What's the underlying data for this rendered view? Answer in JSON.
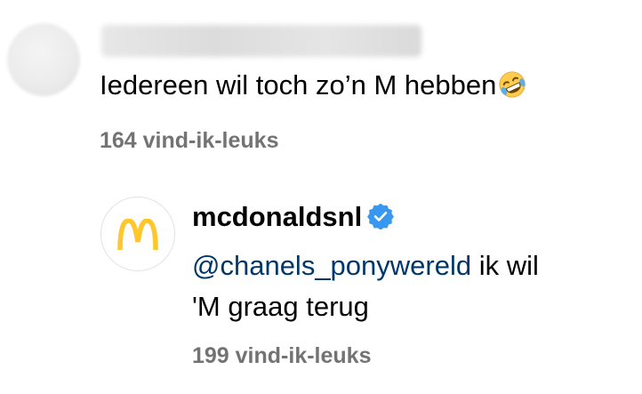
{
  "comment": {
    "username": "chanels_ponywereld",
    "text": "Iedereen wil toch zo’n M hebben",
    "emoji": "rolling-on-the-floor-laughing-emoji",
    "likes": "164 vind-ik-leuks"
  },
  "reply": {
    "username": "mcdonaldsnl",
    "verified_icon": "verified-badge-icon",
    "mention": "@chanels_ponywereld",
    "text_after_mention": " ik wil",
    "text_line2": "'M graag terug",
    "likes": "199 vind-ik-leuks"
  },
  "colors": {
    "mention": "#00376b",
    "secondary_text": "#737373",
    "verified_blue": "#3897f0",
    "mcdonalds_yellow": "#ffc72c"
  }
}
